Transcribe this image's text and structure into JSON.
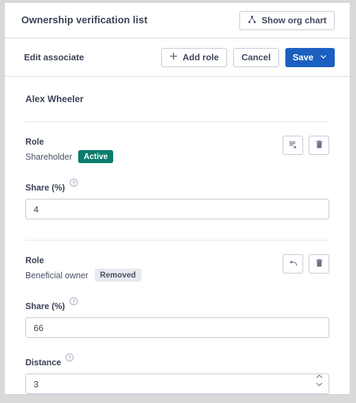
{
  "header": {
    "title": "Ownership verification list",
    "org_chart_button": "Show org chart",
    "org_chart_icon": "org-chart-icon"
  },
  "toolbar": {
    "label": "Edit associate",
    "add_role_label": "Add role",
    "add_role_icon": "plus-icon",
    "cancel_label": "Cancel",
    "save_label": "Save",
    "save_caret_icon": "chevron-down-icon",
    "primary_color": "#1b5fc1"
  },
  "associate": {
    "name": "Alex Wheeler"
  },
  "roles": [
    {
      "label": "Role",
      "value": "Shareholder",
      "status": "Active",
      "status_color": "#0a7d6e",
      "actions": [
        {
          "name": "remove-role-icon",
          "title": "remove-role"
        },
        {
          "name": "delete-icon",
          "title": "delete"
        }
      ],
      "fields": [
        {
          "label": "Share (%)",
          "help_icon": "help-circle-icon",
          "value": "4",
          "type": "text"
        }
      ]
    },
    {
      "label": "Role",
      "value": "Beneficial owner",
      "status": "Removed",
      "status_color": "#e7eaee",
      "actions": [
        {
          "name": "undo-icon",
          "title": "undo"
        },
        {
          "name": "delete-icon",
          "title": "delete"
        }
      ],
      "fields": [
        {
          "label": "Share (%)",
          "help_icon": "help-circle-icon",
          "value": "66",
          "type": "text"
        },
        {
          "label": "Distance",
          "help_icon": "help-circle-icon",
          "value": "3",
          "type": "stepper"
        }
      ]
    }
  ]
}
